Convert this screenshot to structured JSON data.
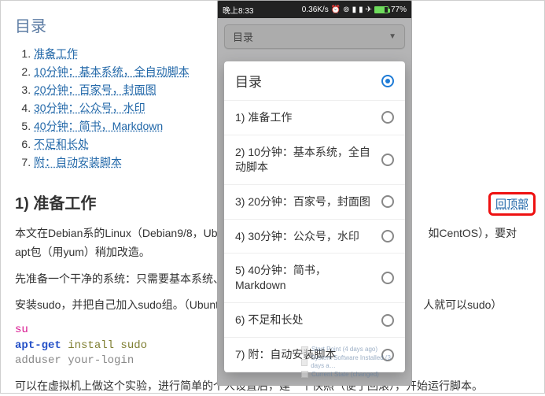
{
  "toc": {
    "title": "目录",
    "items": [
      "准备工作",
      "10分钟：基本系统，全自动脚本",
      "20分钟：百家号，封面图",
      "30分钟：公众号，水印",
      "40分钟：简书，Markdown",
      "不足和长处",
      "附：自动安装脚本"
    ]
  },
  "section": {
    "heading": "1) 准备工作",
    "p1": "本文在Debian系的Linux（Debian9/8，Ubu",
    "p1_tail": "如CentOS），要对apt包（用yum）稍加改造。",
    "p2": "先准备一个干净的系统：只需要基本系统、",
    "p3_a": "安装sudo，并把自己加入sudo组。（Ubunt",
    "p3_b": "人就可以sudo）",
    "p4": "可以在虚拟机上做这个实验，进行简单的个人设置后，建一个快照（便于回滚），开始运行脚本。"
  },
  "code": {
    "l1": "su",
    "l2a": "apt-get",
    "l2b": " install sudo",
    "l3a": "adduser your",
    "l3b": "-login"
  },
  "phone": {
    "status": {
      "time": "晚上8:33",
      "speed": "0.36K/s",
      "battery": "77%"
    },
    "select_label": "目录",
    "modal": {
      "title": "目录",
      "selected_index": -1,
      "header_selected": true,
      "items": [
        "1) 准备工作",
        "2) 10分钟：基本系统，全自动脚本",
        "3) 20分钟：百家号，封面图",
        "4) 30分钟：公众号，水印",
        "5) 40分钟：简书，Markdown",
        "6) 不足和长处",
        "7) 附：自动安装脚本"
      ]
    }
  },
  "back_top": "回顶部"
}
